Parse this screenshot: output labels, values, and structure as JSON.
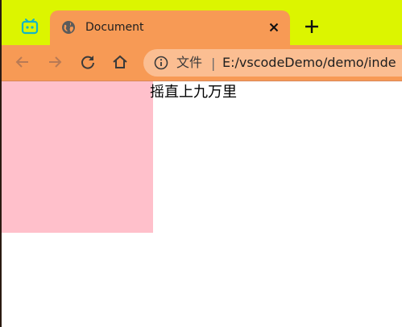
{
  "tabstrip": {
    "app_icon": "bilibili-tv-icon",
    "new_tab_icon": "plus-icon"
  },
  "tab": {
    "favicon": "globe-icon",
    "title": "Document",
    "close_icon": "close-icon"
  },
  "toolbar": {
    "back_icon": "arrow-left-icon",
    "forward_icon": "arrow-right-icon",
    "reload_icon": "reload-icon",
    "home_icon": "home-icon"
  },
  "omnibox": {
    "info_icon": "info-icon",
    "security_label": "文件",
    "separator": "|",
    "url": "E:/vscodeDemo/demo/inde"
  },
  "page": {
    "text": "摇直上九万里"
  },
  "colors": {
    "tabstrip_bg": "#dcf500",
    "tab_bg": "#f79a55",
    "omnibox_bg": "#fbbe92",
    "box_bg": "#ffc0cb",
    "app_icon_color": "#12b5c8"
  }
}
